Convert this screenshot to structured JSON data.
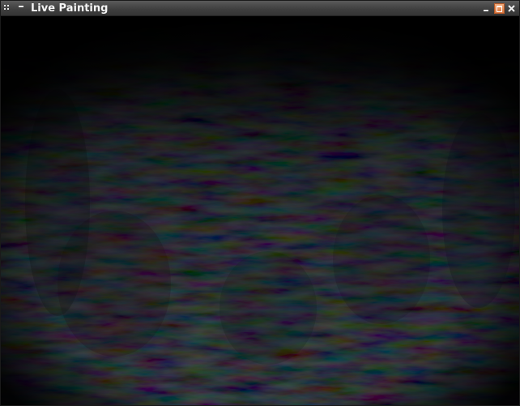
{
  "window": {
    "title": "Live Painting"
  },
  "icons": {
    "menu": "window-menu-icon",
    "shade": "shade-icon",
    "minimize": "minimize-icon",
    "maximize": "maximize-icon",
    "close": "close-icon"
  },
  "colors": {
    "titlebar": "#3e3e3e",
    "title_text": "#f4f4f4",
    "maximize_accent": "#e08a55",
    "canvas_background": "#050505"
  }
}
